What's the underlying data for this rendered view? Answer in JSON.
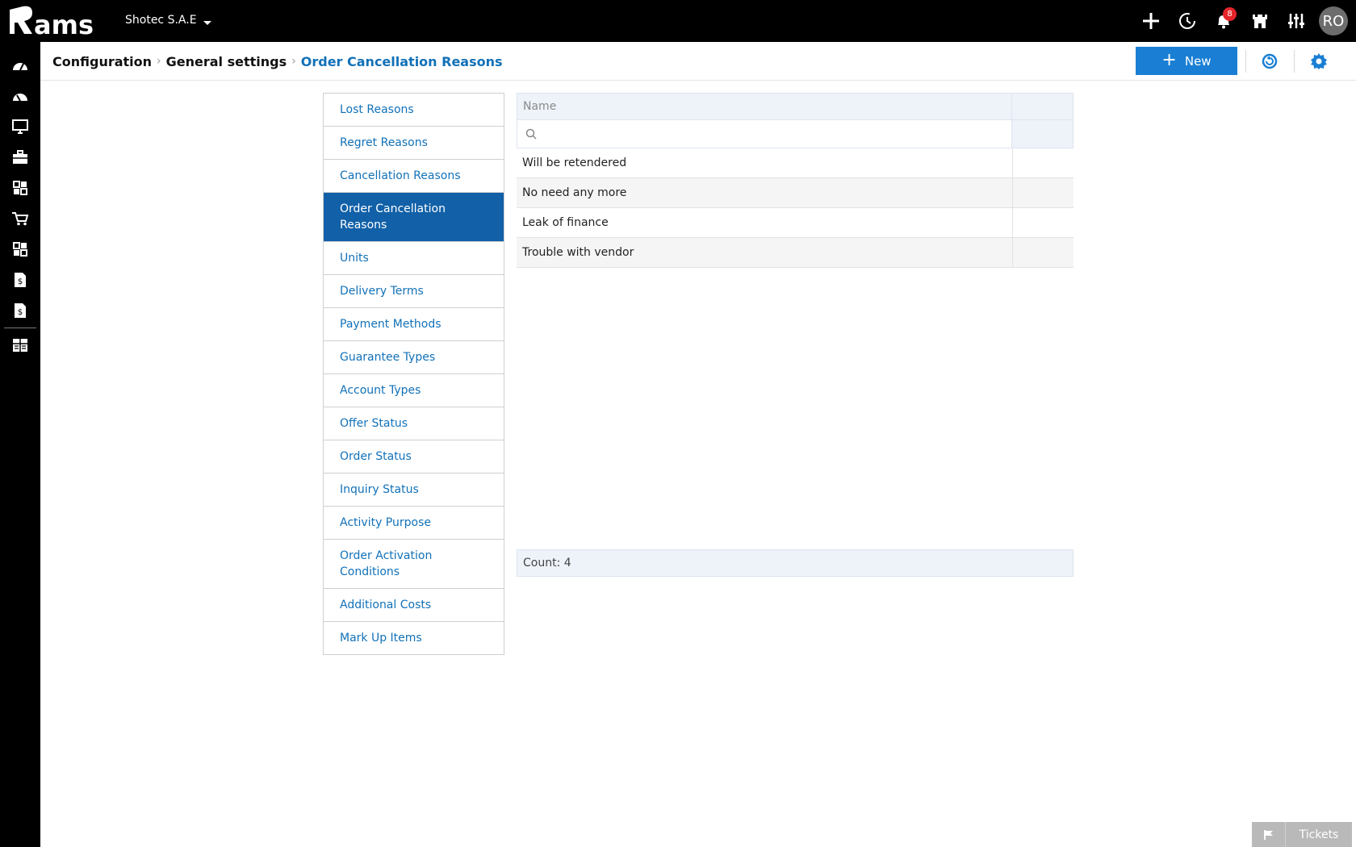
{
  "app": {
    "logo_text": "rams",
    "company": "Shotec S.A.E"
  },
  "topbar": {
    "icons": [
      "plus-icon",
      "history-icon",
      "bell-icon",
      "castle-icon",
      "sliders-icon"
    ],
    "notifications_count": "8",
    "avatar_initials": "RO"
  },
  "leftnav": {
    "icons": [
      "dashboard-icon",
      "dashboard-icon",
      "monitor-icon",
      "briefcase-icon",
      "modules-icon",
      "cart-icon",
      "modules-icon",
      "invoice-icon",
      "invoice-icon",
      "grid-list-icon"
    ]
  },
  "breadcrumb": {
    "items": [
      "Configuration",
      "General settings",
      "Order Cancellation Reasons"
    ]
  },
  "toolbar": {
    "new_label": "New",
    "refresh_icon": "refresh-icon",
    "settings_icon": "settings-gear-icon",
    "accent_color": "#1a7fd4"
  },
  "sidemenu": {
    "items": [
      "Lost Reasons",
      "Regret Reasons",
      "Cancellation Reasons",
      "Order Cancellation Reasons",
      "Units",
      "Delivery Terms",
      "Payment Methods",
      "Guarantee Types",
      "Account Types",
      "Offer Status",
      "Order Status",
      "Inquiry Status",
      "Activity Purpose",
      "Order Activation Conditions",
      "Additional Costs",
      "Mark Up Items"
    ],
    "active_index": 3
  },
  "grid": {
    "column_name": "Name",
    "search_placeholder": "",
    "rows": [
      "Will be retendered",
      "No need any more",
      "Leak of finance",
      "Trouble with vendor"
    ],
    "footer": "Count: 4"
  },
  "tickets": {
    "label": "Tickets"
  }
}
